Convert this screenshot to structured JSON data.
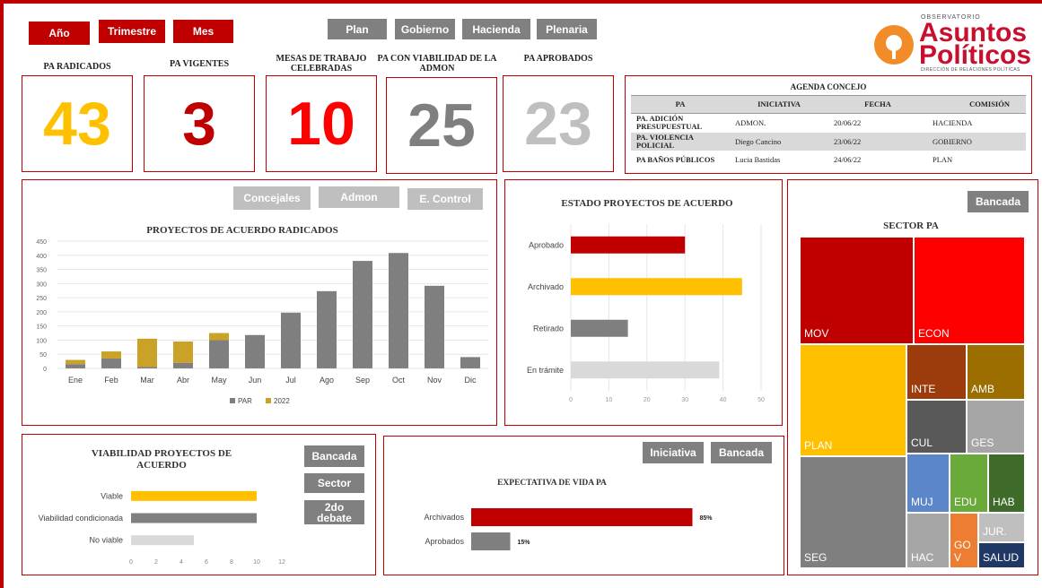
{
  "filters": {
    "period": [
      "Año",
      "Trimestre",
      "Mes"
    ],
    "category": [
      "Plan",
      "Gobierno",
      "Hacienda",
      "Plenaria"
    ]
  },
  "logo": {
    "top": "OBSERVATORIO",
    "line1": "Asuntos",
    "line2": "Políticos",
    "bottom": "DIRECCIÓN DE RELACIONES POLÍTICAS",
    "colors": {
      "red": "#c8102e",
      "orange": "#f28c28"
    }
  },
  "kpis": [
    {
      "label": "PA RADICADOS",
      "value": "43",
      "color": "#ffc000"
    },
    {
      "label": "PA VIGENTES",
      "value": "3",
      "color": "#c00000"
    },
    {
      "label": "MESAS DE TRABAJO CELEBRADAS",
      "value": "10",
      "color": "#ff0000"
    },
    {
      "label": "PA CON VIABILIDAD DE LA ADMON",
      "value": "25",
      "color": "#7f7f7f"
    },
    {
      "label": "PA APROBADOS",
      "value": "23",
      "color": "#bfbfbf"
    }
  ],
  "agenda": {
    "title": "AGENDA CONCEJO",
    "headers": [
      "PA",
      "INICIATIVA",
      "FECHA",
      "COMISIÓN"
    ],
    "rows": [
      [
        "PA. ADICIÓN PRESUPUESTUAL",
        "ADMON.",
        "20/06/22",
        "HACIENDA"
      ],
      [
        "PA. VIOLENCIA POLICIAL",
        "Diego Cancino",
        "23/06/22",
        "GOBIERNO"
      ],
      [
        "PA BAÑOS PÚBLICOS",
        "Lucia Bastidas",
        "24/06/22",
        "PLAN"
      ]
    ]
  },
  "radicados_panel": {
    "buttons": [
      "Concejales",
      "Admon",
      "E. Control"
    ]
  },
  "estado_panel": {},
  "viabilidad_panel": {
    "buttons": [
      "Bancada",
      "Sector",
      "2do debate"
    ]
  },
  "expectativa_panel": {
    "buttons": [
      "Iniciativa",
      "Bancada"
    ]
  },
  "sector_panel": {
    "button": "Bancada",
    "title": "SECTOR PA",
    "tiles": [
      {
        "label": "MOV",
        "color": "#c00000"
      },
      {
        "label": "ECON",
        "color": "#ff0000"
      },
      {
        "label": "PLAN",
        "color": "#ffc000"
      },
      {
        "label": "INTE",
        "color": "#9c3c0c"
      },
      {
        "label": "AMB",
        "color": "#9c6e00"
      },
      {
        "label": "CUL",
        "color": "#595959"
      },
      {
        "label": "GES",
        "color": "#a6a6a6"
      },
      {
        "label": "SEG",
        "color": "#7f7f7f"
      },
      {
        "label": "MUJ",
        "color": "#5b86c9"
      },
      {
        "label": "EDU",
        "color": "#6aaa3a"
      },
      {
        "label": "HAB",
        "color": "#3f6b2a"
      },
      {
        "label": "HAC",
        "color": "#a6a6a6"
      },
      {
        "label": "GO V",
        "color": "#ed7d31"
      },
      {
        "label": "JUR.",
        "color": "#bfbfbf"
      },
      {
        "label": "SALUD",
        "color": "#203864"
      }
    ]
  },
  "chart_data": [
    {
      "type": "bar",
      "title": "PROYECTOS DE ACUERDO RADICADOS",
      "stacked": true,
      "categories": [
        "Ene",
        "Feb",
        "Mar",
        "Abr",
        "May",
        "Jun",
        "Jul",
        "Ago",
        "Sep",
        "Oct",
        "Nov",
        "Dic"
      ],
      "series": [
        {
          "name": "PAR",
          "color": "#7f7f7f",
          "values": [
            15,
            35,
            5,
            20,
            100,
            118,
            197,
            273,
            380,
            408,
            292,
            40
          ]
        },
        {
          "name": "2022",
          "color": "#c9a227",
          "values": [
            15,
            25,
            100,
            75,
            25,
            0,
            0,
            0,
            0,
            0,
            0,
            0
          ]
        }
      ],
      "ylim": [
        0,
        450
      ],
      "yticks": [
        0,
        50,
        100,
        150,
        200,
        250,
        300,
        350,
        400,
        450
      ],
      "grid": true,
      "legend": "bottom"
    },
    {
      "type": "bar",
      "orientation": "horizontal",
      "title": "ESTADO PROYECTOS DE ACUERDO",
      "categories": [
        "Aprobado",
        "Archivado",
        "Retirado",
        "En trámite"
      ],
      "values": [
        30,
        45,
        15,
        39
      ],
      "colors": [
        "#c00000",
        "#ffc000",
        "#7f7f7f",
        "#d9d9d9"
      ],
      "xlim": [
        0,
        50
      ],
      "xticks": [
        0,
        10,
        20,
        30,
        40,
        50
      ],
      "grid": true
    },
    {
      "type": "bar",
      "orientation": "horizontal",
      "title": "VIABILIDAD PROYECTOS DE ACUERDO",
      "categories": [
        "Viable",
        "Viabilidad condicionada",
        "No viable"
      ],
      "values": [
        10,
        10,
        5
      ],
      "colors": [
        "#ffc000",
        "#7f7f7f",
        "#d9d9d9"
      ],
      "xlim": [
        0,
        12
      ],
      "xticks": [
        0,
        2,
        4,
        6,
        8,
        10,
        12
      ]
    },
    {
      "type": "bar",
      "orientation": "horizontal",
      "title": "EXPECTATIVA DE VIDA PA",
      "categories": [
        "Archivados",
        "Aprobados"
      ],
      "values": [
        85,
        15
      ],
      "labels": [
        "85%",
        "15%"
      ],
      "colors": [
        "#c00000",
        "#7f7f7f"
      ],
      "xlim": [
        0,
        100
      ]
    }
  ]
}
